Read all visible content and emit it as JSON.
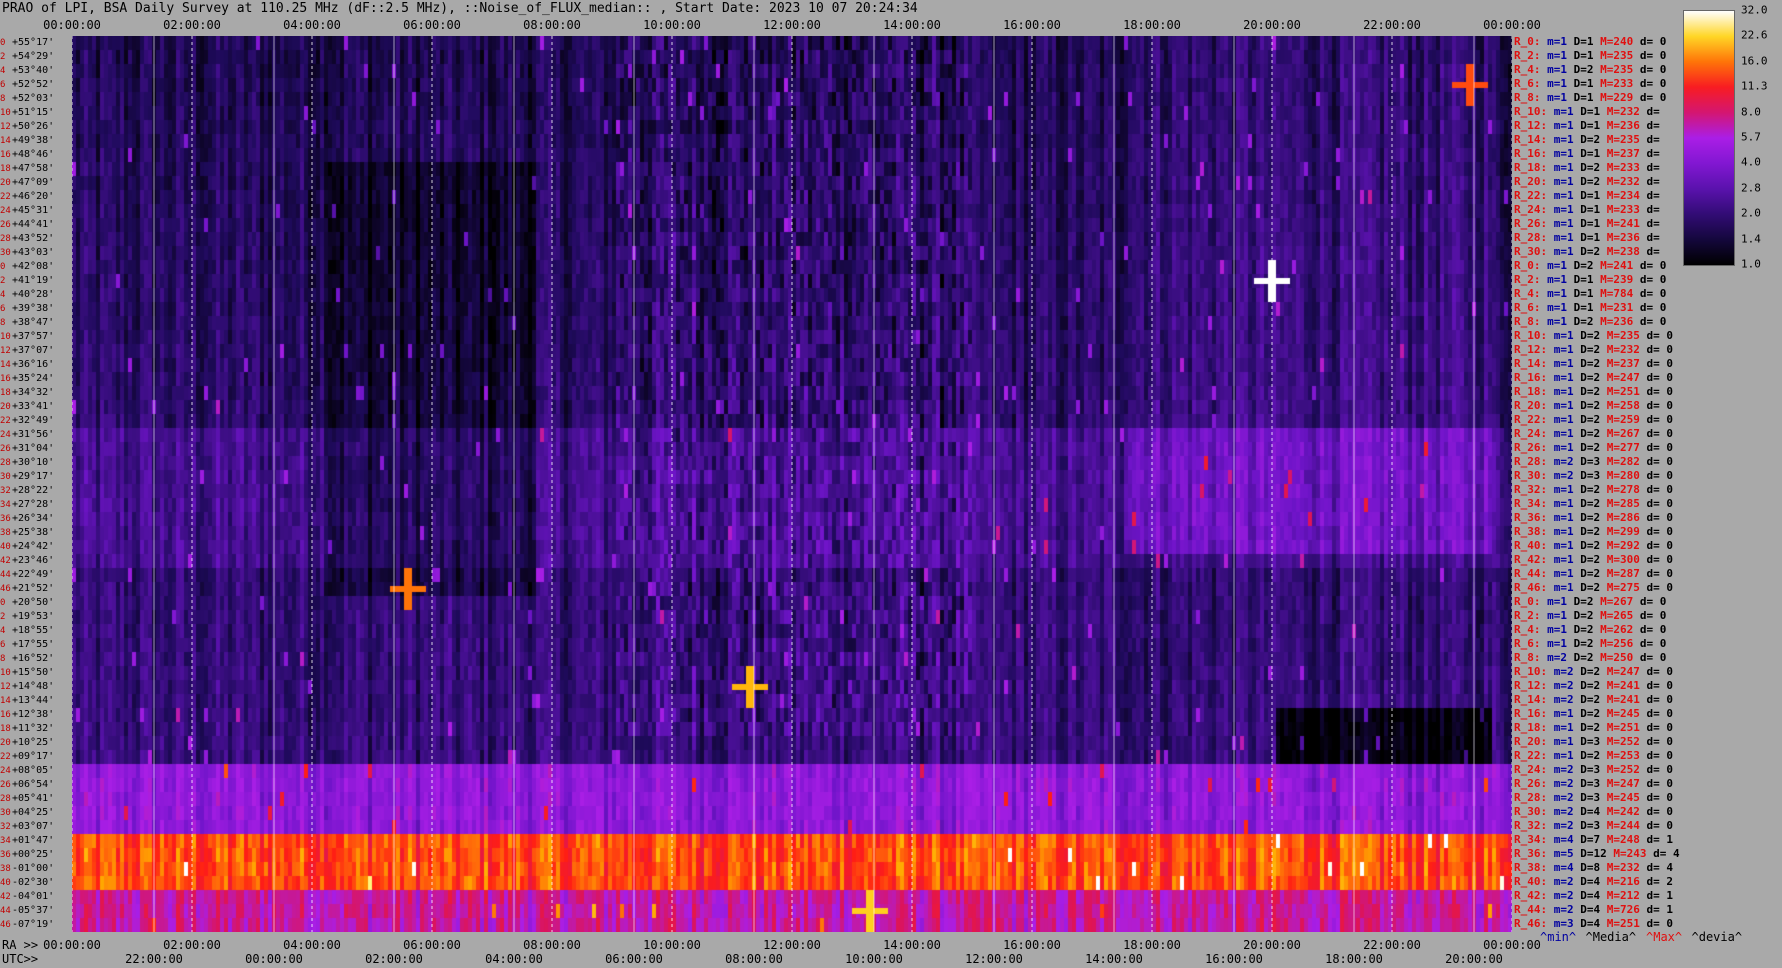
{
  "title": "PRAO of LPI, BSA Daily Survey at 110.25 MHz (dF::2.5 MHz), ::Noise_of_FLUX_median:: , Start Date: 2023 10 07 20:24:34",
  "axis_labels": {
    "ra": "RA >>",
    "utc": "UTC>>"
  },
  "legend": [
    {
      "label": "^min^",
      "color": "#0000a0"
    },
    {
      "label": "^Media^",
      "color": "#000000"
    },
    {
      "label": "^Max^",
      "color": "#e01010"
    },
    {
      "label": "^devia^",
      "color": "#000000"
    }
  ],
  "chart_data": {
    "type": "heatmap",
    "title": "PRAO of LPI, BSA Daily Survey at 110.25 MHz (dF::2.5 MHz), ::Noise_of_FLUX_median:: , Start Date: 2023 10 07 20:24:34",
    "x_top_ticks": [
      "00:00:00",
      "02:00:00",
      "04:00:00",
      "06:00:00",
      "08:00:00",
      "10:00:00",
      "12:00:00",
      "14:00:00",
      "16:00:00",
      "18:00:00",
      "20:00:00",
      "22:00:00",
      "00:00:00"
    ],
    "ra_ticks": [
      "00:00:00",
      "02:00:00",
      "04:00:00",
      "06:00:00",
      "08:00:00",
      "10:00:00",
      "12:00:00",
      "14:00:00",
      "16:00:00",
      "18:00:00",
      "20:00:00",
      "22:00:00",
      "00:00:00"
    ],
    "utc_ticks": [
      "22:00:00",
      "00:00:00",
      "02:00:00",
      "04:00:00",
      "06:00:00",
      "08:00:00",
      "10:00:00",
      "12:00:00",
      "14:00:00",
      "16:00:00",
      "18:00:00",
      "20:00:00"
    ],
    "colorbar": {
      "ticks": [
        "32.0",
        "22.6",
        "16.0",
        "11.3",
        "8.0",
        "5.7",
        "4.0",
        "2.8",
        "2.0",
        "1.4",
        "1.0"
      ],
      "range": [
        1.0,
        32.0
      ],
      "scale": "log"
    },
    "rows": [
      {
        "idx": "0",
        "dec": "+55°17'"
      },
      {
        "idx": "2",
        "dec": "+54°29'"
      },
      {
        "idx": "4",
        "dec": "+53°40'"
      },
      {
        "idx": "6",
        "dec": "+52°52'"
      },
      {
        "idx": "8",
        "dec": "+52°03'"
      },
      {
        "idx": "10",
        "dec": "+51°15'"
      },
      {
        "idx": "12",
        "dec": "+50°26'"
      },
      {
        "idx": "14",
        "dec": "+49°38'"
      },
      {
        "idx": "16",
        "dec": "+48°46'"
      },
      {
        "idx": "18",
        "dec": "+47°58'"
      },
      {
        "idx": "20",
        "dec": "+47°09'"
      },
      {
        "idx": "22",
        "dec": "+46°20'"
      },
      {
        "idx": "24",
        "dec": "+45°31'"
      },
      {
        "idx": "26",
        "dec": "+44°41'"
      },
      {
        "idx": "28",
        "dec": "+43°52'"
      },
      {
        "idx": "30",
        "dec": "+43°03'"
      },
      {
        "idx": "0",
        "dec": "+42°08'"
      },
      {
        "idx": "2",
        "dec": "+41°19'"
      },
      {
        "idx": "4",
        "dec": "+40°28'"
      },
      {
        "idx": "6",
        "dec": "+39°38'"
      },
      {
        "idx": "8",
        "dec": "+38°47'"
      },
      {
        "idx": "10",
        "dec": "+37°57'"
      },
      {
        "idx": "12",
        "dec": "+37°07'"
      },
      {
        "idx": "14",
        "dec": "+36°16'"
      },
      {
        "idx": "16",
        "dec": "+35°24'"
      },
      {
        "idx": "18",
        "dec": "+34°32'"
      },
      {
        "idx": "20",
        "dec": "+33°41'"
      },
      {
        "idx": "22",
        "dec": "+32°49'"
      },
      {
        "idx": "24",
        "dec": "+31°56'"
      },
      {
        "idx": "26",
        "dec": "+31°04'"
      },
      {
        "idx": "28",
        "dec": "+30°10'"
      },
      {
        "idx": "30",
        "dec": "+29°17'"
      },
      {
        "idx": "32",
        "dec": "+28°22'"
      },
      {
        "idx": "34",
        "dec": "+27°28'"
      },
      {
        "idx": "36",
        "dec": "+26°34'"
      },
      {
        "idx": "38",
        "dec": "+25°38'"
      },
      {
        "idx": "40",
        "dec": "+24°42'"
      },
      {
        "idx": "42",
        "dec": "+23°46'"
      },
      {
        "idx": "44",
        "dec": "+22°49'"
      },
      {
        "idx": "46",
        "dec": "+21°52'"
      },
      {
        "idx": "0",
        "dec": "+20°50'"
      },
      {
        "idx": "2",
        "dec": "+19°53'"
      },
      {
        "idx": "4",
        "dec": "+18°55'"
      },
      {
        "idx": "6",
        "dec": "+17°55'"
      },
      {
        "idx": "8",
        "dec": "+16°52'"
      },
      {
        "idx": "10",
        "dec": "+15°50'"
      },
      {
        "idx": "12",
        "dec": "+14°48'"
      },
      {
        "idx": "14",
        "dec": "+13°44'"
      },
      {
        "idx": "16",
        "dec": "+12°38'"
      },
      {
        "idx": "18",
        "dec": "+11°32'"
      },
      {
        "idx": "20",
        "dec": "+10°25'"
      },
      {
        "idx": "22",
        "dec": "+09°17'"
      },
      {
        "idx": "24",
        "dec": "+08°05'"
      },
      {
        "idx": "26",
        "dec": "+06°54'"
      },
      {
        "idx": "28",
        "dec": "+05°41'"
      },
      {
        "idx": "30",
        "dec": "+04°25'"
      },
      {
        "idx": "32",
        "dec": "+03°07'"
      },
      {
        "idx": "34",
        "dec": "+01°47'"
      },
      {
        "idx": "36",
        "dec": "+00°25'"
      },
      {
        "idx": "38",
        "dec": "-01°00'"
      },
      {
        "idx": "40",
        "dec": "-02°30'"
      },
      {
        "idx": "42",
        "dec": "-04°01'"
      },
      {
        "idx": "44",
        "dec": "-05°37'"
      },
      {
        "idx": "46",
        "dec": "-07°19'"
      }
    ],
    "stats": [
      {
        "r": "R_0:",
        "m": "m=1",
        "d": "D=1",
        "h": "M=240",
        "v": "d= 0"
      },
      {
        "r": "R_2:",
        "m": "m=1",
        "d": "D=1",
        "h": "M=235",
        "v": "d= 0"
      },
      {
        "r": "R_4:",
        "m": "m=1",
        "d": "D=2",
        "h": "M=235",
        "v": "d= 0"
      },
      {
        "r": "R_6:",
        "m": "m=1",
        "d": "D=1",
        "h": "M=233",
        "v": "d= 0"
      },
      {
        "r": "R_8:",
        "m": "m=1",
        "d": "D=1",
        "h": "M=229",
        "v": "d= 0"
      },
      {
        "r": "R_10:",
        "m": "m=1",
        "d": "D=1",
        "h": "M=232",
        "v": "d="
      },
      {
        "r": "R_12:",
        "m": "m=1",
        "d": "D=1",
        "h": "M=236",
        "v": "d="
      },
      {
        "r": "R_14:",
        "m": "m=1",
        "d": "D=2",
        "h": "M=235",
        "v": "d="
      },
      {
        "r": "R_16:",
        "m": "m=1",
        "d": "D=1",
        "h": "M=237",
        "v": "d="
      },
      {
        "r": "R_18:",
        "m": "m=1",
        "d": "D=2",
        "h": "M=233",
        "v": "d="
      },
      {
        "r": "R_20:",
        "m": "m=1",
        "d": "D=2",
        "h": "M=232",
        "v": "d="
      },
      {
        "r": "R_22:",
        "m": "m=1",
        "d": "D=1",
        "h": "M=234",
        "v": "d="
      },
      {
        "r": "R_24:",
        "m": "m=1",
        "d": "D=1",
        "h": "M=233",
        "v": "d="
      },
      {
        "r": "R_26:",
        "m": "m=1",
        "d": "D=1",
        "h": "M=241",
        "v": "d="
      },
      {
        "r": "R_28:",
        "m": "m=1",
        "d": "D=1",
        "h": "M=236",
        "v": "d="
      },
      {
        "r": "R_30:",
        "m": "m=1",
        "d": "D=2",
        "h": "M=238",
        "v": "d="
      },
      {
        "r": "R_0:",
        "m": "m=1",
        "d": "D=2",
        "h": "M=241",
        "v": "d= 0"
      },
      {
        "r": "R_2:",
        "m": "m=1",
        "d": "D=1",
        "h": "M=239",
        "v": "d= 0"
      },
      {
        "r": "R_4:",
        "m": "m=1",
        "d": "D=1",
        "h": "M=784",
        "v": "d= 0"
      },
      {
        "r": "R_6:",
        "m": "m=1",
        "d": "D=1",
        "h": "M=231",
        "v": "d= 0"
      },
      {
        "r": "R_8:",
        "m": "m=1",
        "d": "D=2",
        "h": "M=236",
        "v": "d= 0"
      },
      {
        "r": "R_10:",
        "m": "m=1",
        "d": "D=2",
        "h": "M=235",
        "v": "d= 0"
      },
      {
        "r": "R_12:",
        "m": "m=1",
        "d": "D=2",
        "h": "M=232",
        "v": "d= 0"
      },
      {
        "r": "R_14:",
        "m": "m=1",
        "d": "D=2",
        "h": "M=237",
        "v": "d= 0"
      },
      {
        "r": "R_16:",
        "m": "m=1",
        "d": "D=2",
        "h": "M=247",
        "v": "d= 0"
      },
      {
        "r": "R_18:",
        "m": "m=1",
        "d": "D=2",
        "h": "M=251",
        "v": "d= 0"
      },
      {
        "r": "R_20:",
        "m": "m=1",
        "d": "D=2",
        "h": "M=258",
        "v": "d= 0"
      },
      {
        "r": "R_22:",
        "m": "m=1",
        "d": "D=2",
        "h": "M=259",
        "v": "d= 0"
      },
      {
        "r": "R_24:",
        "m": "m=1",
        "d": "D=2",
        "h": "M=267",
        "v": "d= 0"
      },
      {
        "r": "R_26:",
        "m": "m=1",
        "d": "D=2",
        "h": "M=277",
        "v": "d= 0"
      },
      {
        "r": "R_28:",
        "m": "m=2",
        "d": "D=3",
        "h": "M=282",
        "v": "d= 0"
      },
      {
        "r": "R_30:",
        "m": "m=2",
        "d": "D=3",
        "h": "M=280",
        "v": "d= 0"
      },
      {
        "r": "R_32:",
        "m": "m=1",
        "d": "D=2",
        "h": "M=278",
        "v": "d= 0"
      },
      {
        "r": "R_34:",
        "m": "m=1",
        "d": "D=2",
        "h": "M=285",
        "v": "d= 0"
      },
      {
        "r": "R_36:",
        "m": "m=1",
        "d": "D=2",
        "h": "M=286",
        "v": "d= 0"
      },
      {
        "r": "R_38:",
        "m": "m=1",
        "d": "D=2",
        "h": "M=299",
        "v": "d= 0"
      },
      {
        "r": "R_40:",
        "m": "m=1",
        "d": "D=2",
        "h": "M=292",
        "v": "d= 0"
      },
      {
        "r": "R_42:",
        "m": "m=1",
        "d": "D=2",
        "h": "M=300",
        "v": "d= 0"
      },
      {
        "r": "R_44:",
        "m": "m=1",
        "d": "D=2",
        "h": "M=287",
        "v": "d= 0"
      },
      {
        "r": "R_46:",
        "m": "m=1",
        "d": "D=2",
        "h": "M=275",
        "v": "d= 0"
      },
      {
        "r": "R_0:",
        "m": "m=1",
        "d": "D=2",
        "h": "M=267",
        "v": "d= 0"
      },
      {
        "r": "R_2:",
        "m": "m=1",
        "d": "D=2",
        "h": "M=265",
        "v": "d= 0"
      },
      {
        "r": "R_4:",
        "m": "m=1",
        "d": "D=2",
        "h": "M=262",
        "v": "d= 0"
      },
      {
        "r": "R_6:",
        "m": "m=1",
        "d": "D=2",
        "h": "M=256",
        "v": "d= 0"
      },
      {
        "r": "R_8:",
        "m": "m=2",
        "d": "D=2",
        "h": "M=250",
        "v": "d= 0"
      },
      {
        "r": "R_10:",
        "m": "m=2",
        "d": "D=2",
        "h": "M=247",
        "v": "d= 0"
      },
      {
        "r": "R_12:",
        "m": "m=2",
        "d": "D=2",
        "h": "M=241",
        "v": "d= 0"
      },
      {
        "r": "R_14:",
        "m": "m=2",
        "d": "D=2",
        "h": "M=241",
        "v": "d= 0"
      },
      {
        "r": "R_16:",
        "m": "m=1",
        "d": "D=2",
        "h": "M=245",
        "v": "d= 0"
      },
      {
        "r": "R_18:",
        "m": "m=1",
        "d": "D=2",
        "h": "M=251",
        "v": "d= 0"
      },
      {
        "r": "R_20:",
        "m": "m=1",
        "d": "D=3",
        "h": "M=252",
        "v": "d= 0"
      },
      {
        "r": "R_22:",
        "m": "m=1",
        "d": "D=2",
        "h": "M=253",
        "v": "d= 0"
      },
      {
        "r": "R_24:",
        "m": "m=2",
        "d": "D=3",
        "h": "M=252",
        "v": "d= 0"
      },
      {
        "r": "R_26:",
        "m": "m=2",
        "d": "D=3",
        "h": "M=247",
        "v": "d= 0"
      },
      {
        "r": "R_28:",
        "m": "m=2",
        "d": "D=3",
        "h": "M=245",
        "v": "d= 0"
      },
      {
        "r": "R_30:",
        "m": "m=2",
        "d": "D=4",
        "h": "M=242",
        "v": "d= 0"
      },
      {
        "r": "R_32:",
        "m": "m=2",
        "d": "D=3",
        "h": "M=244",
        "v": "d= 0"
      },
      {
        "r": "R_34:",
        "m": "m=4",
        "d": "D=7",
        "h": "M=248",
        "v": "d= 1"
      },
      {
        "r": "R_36:",
        "m": "m=5",
        "d": "D=12",
        "h": "M=243",
        "v": "d= 4"
      },
      {
        "r": "R_38:",
        "m": "m=4",
        "d": "D=8",
        "h": "M=232",
        "v": "d= 4"
      },
      {
        "r": "R_40:",
        "m": "m=2",
        "d": "D=4",
        "h": "M=216",
        "v": "d= 2"
      },
      {
        "r": "R_42:",
        "m": "m=2",
        "d": "D=4",
        "h": "M=212",
        "v": "d= 1"
      },
      {
        "r": "R_44:",
        "m": "m=2",
        "d": "D=4",
        "h": "M=726",
        "v": "d= 1"
      },
      {
        "r": "R_46:",
        "m": "m=3",
        "d": "D=4",
        "h": "M=251",
        "v": "d= 0"
      }
    ],
    "bright_sources": [
      {
        "x_hours": 20.0,
        "row": 17,
        "level": 32
      },
      {
        "x_hours": 11.3,
        "row": 46,
        "level": 20
      },
      {
        "x_hours": 13.3,
        "row": 62,
        "level": 22
      },
      {
        "x_hours": 5.6,
        "row": 39,
        "level": 16
      },
      {
        "x_hours": 23.3,
        "row": 3,
        "level": 14
      }
    ]
  }
}
